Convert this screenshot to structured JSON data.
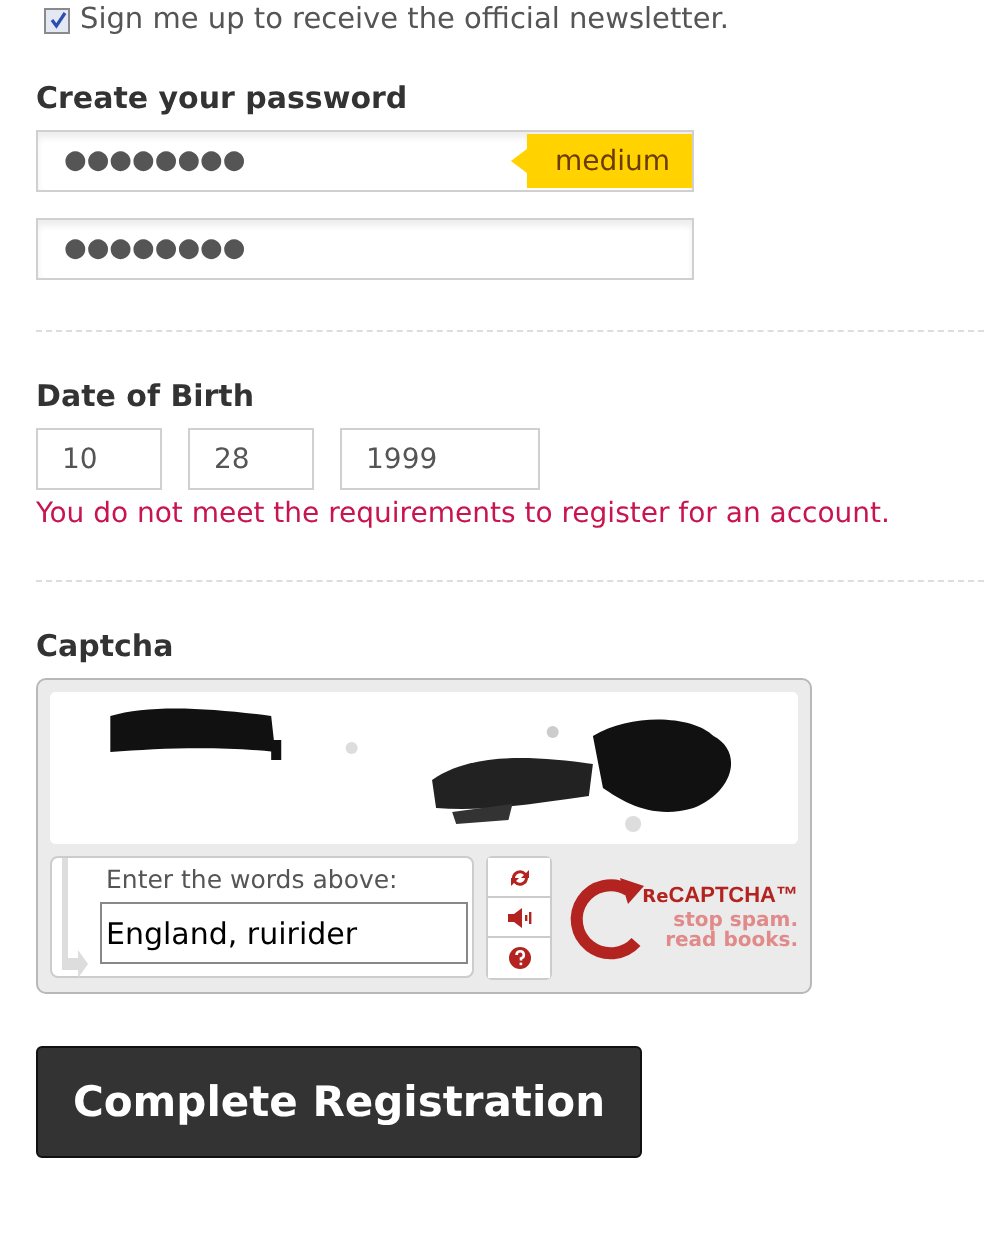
{
  "newsletter": {
    "label": "Sign me up to receive the official newsletter.",
    "checked": true
  },
  "password": {
    "heading": "Create your password",
    "value": "●●●●●●●●",
    "strength": "medium",
    "confirm_value": "●●●●●●●●"
  },
  "birth_date": {
    "heading": "Date of Birth",
    "month": "10",
    "day": "28",
    "year": "1999",
    "error": "You do not meet the requirements to register for an account."
  },
  "captcha": {
    "heading": "Captcha",
    "prompt": "Enter the words above:",
    "value": "England, ruirider",
    "logo_re": "Re",
    "logo_name": "CAPTCHA™",
    "logo_tagline_1": "stop spam.",
    "logo_tagline_2": "read books."
  },
  "submit": {
    "label": "Complete Registration"
  }
}
